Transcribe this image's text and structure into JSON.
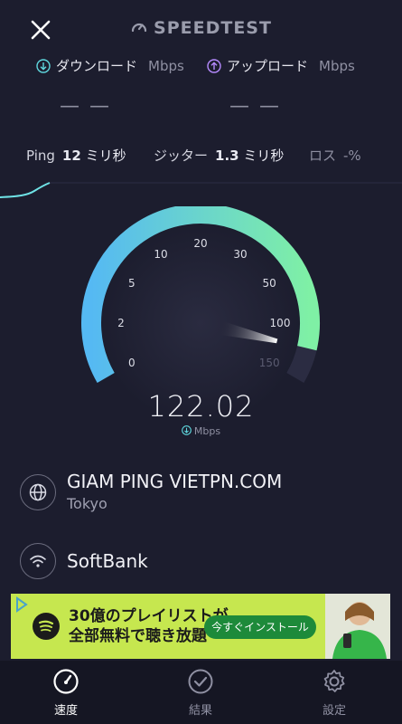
{
  "header": {
    "brand": "SPEEDTEST",
    "close_icon": "close-icon",
    "brand_icon": "speedometer-icon"
  },
  "download": {
    "label": "ダウンロード",
    "unit": "Mbps",
    "value": "— —",
    "icon": "download-arrow-icon"
  },
  "upload": {
    "label": "アップロード",
    "unit": "Mbps",
    "value": "— —",
    "icon": "upload-arrow-icon"
  },
  "stats": {
    "ping": {
      "label": "Ping",
      "value": "12",
      "unit": "ミリ秒"
    },
    "jitter": {
      "label": "ジッター",
      "value": "1.3",
      "unit": "ミリ秒"
    },
    "loss": {
      "label": "ロス",
      "value": "-%"
    }
  },
  "gauge": {
    "value": "122.02",
    "unit": "Mbps",
    "needle_mbps": 122.02,
    "ticks": [
      "0",
      "2",
      "5",
      "10",
      "20",
      "30",
      "50",
      "100",
      "150"
    ],
    "colors": {
      "start": "#55b9f3",
      "end": "#7ff0a5",
      "track": "#2b2c42"
    }
  },
  "server": {
    "name": "GIAM PING VIETPN.COM",
    "location": "Tokyo",
    "icon": "globe-icon"
  },
  "isp": {
    "name": "SoftBank",
    "icon": "wifi-icon"
  },
  "ad": {
    "line1": "30億のプレイリストが",
    "line2": "全部無料で聴き放題",
    "cta": "今すぐインストール",
    "logo_icon": "spotify-logo",
    "play_icon": "ad-choice-icon"
  },
  "tabs": [
    {
      "label": "速度",
      "icon": "speedometer-icon",
      "active": true
    },
    {
      "label": "結果",
      "icon": "check-circle-icon",
      "active": false
    },
    {
      "label": "設定",
      "icon": "gear-icon",
      "active": false
    }
  ]
}
